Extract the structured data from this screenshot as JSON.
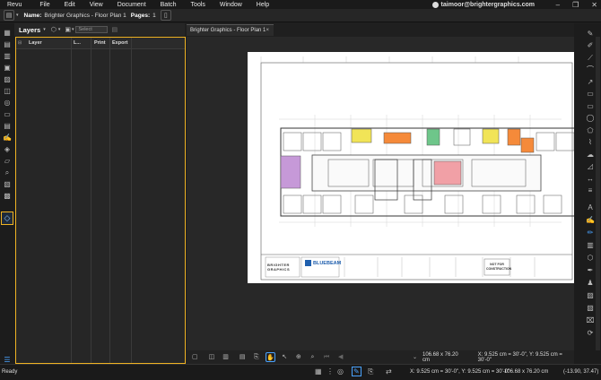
{
  "menu": [
    "Revu",
    "File",
    "Edit",
    "View",
    "Document",
    "Batch",
    "Tools",
    "Window",
    "Help"
  ],
  "user": {
    "email": "taimoor@brightergraphics.com"
  },
  "docbar": {
    "name_label": "Name:",
    "name_value": "Brighter Graphics - Floor Plan 1",
    "pages_label": "Pages:",
    "pages_value": "1"
  },
  "layers": {
    "title": "Layers",
    "select_placeholder": "Select",
    "columns": [
      "Layer",
      "L...",
      "Print",
      "Export"
    ]
  },
  "tab": {
    "label": "Brighter Graphics - Floor Plan 1",
    "close": "×"
  },
  "drawing": {
    "brand1": "BRIGHTER GRAPHICS",
    "brand2": "BLUEBEAM",
    "stamp": "NOT FOR CONSTRUCTION"
  },
  "bottom": {
    "page_size": "106.68 x 76.20 cm",
    "coords": "X: 9.525 cm = 30'-0\", Y: 9.525 cm = 30'-0\""
  },
  "status": {
    "ready": "Ready",
    "coords": "X: 9.525 cm = 30'-0\", Y: 9.525 cm = 30'-0\"",
    "size": "106.68 x 76.20 cm",
    "xy": "(-13.90, 37.47)"
  }
}
